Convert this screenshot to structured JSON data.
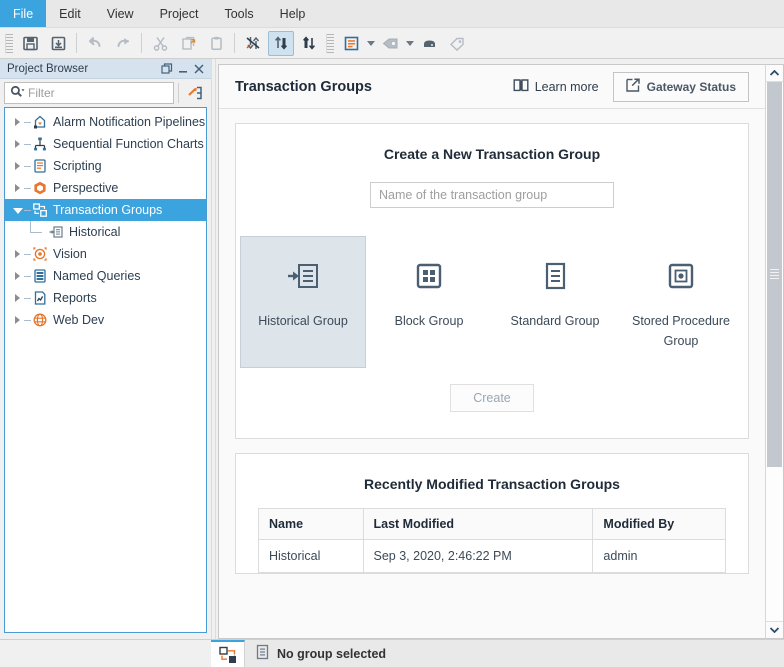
{
  "window": {
    "menu": [
      {
        "label": "File",
        "active": true
      },
      {
        "label": "Edit",
        "active": false
      },
      {
        "label": "View",
        "active": false
      },
      {
        "label": "Project",
        "active": false
      },
      {
        "label": "Tools",
        "active": false
      },
      {
        "label": "Help",
        "active": false
      }
    ],
    "toolbar": {
      "buttons": [
        {
          "name": "save-icon",
          "tooltip": "Save"
        },
        {
          "name": "save-all-icon",
          "tooltip": "Save All"
        },
        {
          "name": "undo-arrow-icon",
          "tooltip": "Undo"
        },
        {
          "name": "redo-arrow-icon",
          "tooltip": "Redo"
        },
        {
          "name": "cut-scissors-icon",
          "tooltip": "Cut"
        },
        {
          "name": "copy-icon",
          "tooltip": "Copy"
        },
        {
          "name": "paste-clipboard-icon",
          "tooltip": "Paste"
        },
        {
          "name": "disconnect-icon",
          "tooltip": "Disconnect"
        },
        {
          "name": "comm-read-write-icon",
          "tooltip": "Comm Read/Write",
          "selected": true
        },
        {
          "name": "comm-read-only-icon",
          "tooltip": "Comm Read Only"
        },
        {
          "name": "designer-mode-icon",
          "tooltip": "Designer Mode"
        },
        {
          "name": "tag-icon",
          "tooltip": "Tag Browser"
        },
        {
          "name": "database-icon",
          "tooltip": "Database"
        },
        {
          "name": "tags-icon",
          "tooltip": "Tags"
        }
      ]
    }
  },
  "project_browser": {
    "title": "Project Browser",
    "window_buttons": [
      {
        "name": "maximize-panel-icon"
      },
      {
        "name": "minimize-panel-icon"
      },
      {
        "name": "close-panel-icon"
      }
    ],
    "filter": {
      "placeholder": "Filter",
      "value": "",
      "search_icon": "search-dropdown-icon"
    },
    "goto_button": {
      "name": "jump-to-icon"
    },
    "tree": [
      {
        "label": "Alarm Notification Pipelines",
        "icon": "alarm-pipeline-icon",
        "expandable": true,
        "expanded": false,
        "depth": 0,
        "selected": false
      },
      {
        "label": "Sequential Function Charts",
        "icon": "sfc-icon",
        "expandable": true,
        "expanded": false,
        "depth": 0,
        "selected": false
      },
      {
        "label": "Scripting",
        "icon": "script-icon",
        "expandable": true,
        "expanded": false,
        "depth": 0,
        "selected": false
      },
      {
        "label": "Perspective",
        "icon": "perspective-icon",
        "expandable": true,
        "expanded": false,
        "depth": 0,
        "selected": false
      },
      {
        "label": "Transaction Groups",
        "icon": "transaction-group-icon",
        "expandable": true,
        "expanded": true,
        "depth": 0,
        "selected": true
      },
      {
        "label": "Historical",
        "icon": "historical-group-icon",
        "expandable": false,
        "expanded": false,
        "depth": 1,
        "selected": false
      },
      {
        "label": "Vision",
        "icon": "vision-icon",
        "expandable": true,
        "expanded": false,
        "depth": 0,
        "selected": false
      },
      {
        "label": "Named Queries",
        "icon": "named-query-icon",
        "expandable": true,
        "expanded": false,
        "depth": 0,
        "selected": false
      },
      {
        "label": "Reports",
        "icon": "report-icon",
        "expandable": true,
        "expanded": false,
        "depth": 0,
        "selected": false
      },
      {
        "label": "Web Dev",
        "icon": "webdev-globe-icon",
        "expandable": true,
        "expanded": false,
        "depth": 0,
        "selected": false
      }
    ]
  },
  "workspace": {
    "header": {
      "title": "Transaction Groups",
      "learn_more": {
        "label": "Learn more",
        "icon": "book-icon"
      },
      "gateway_status": {
        "label": "Gateway Status",
        "icon": "external-link-icon"
      }
    },
    "create_card": {
      "title": "Create a New Transaction Group",
      "name_input": {
        "placeholder": "Name of the transaction group",
        "value": ""
      },
      "types": [
        {
          "label": "Historical Group",
          "icon": "historical-group-icon",
          "selected": true
        },
        {
          "label": "Block Group",
          "icon": "block-group-icon",
          "selected": false
        },
        {
          "label": "Standard Group",
          "icon": "standard-group-icon",
          "selected": false
        },
        {
          "label": "Stored Procedure Group",
          "icon": "stored-procedure-group-icon",
          "selected": false
        }
      ],
      "create_button": {
        "label": "Create",
        "enabled": false
      }
    },
    "recent_card": {
      "title": "Recently Modified Transaction Groups",
      "columns": [
        "Name",
        "Last Modified",
        "Modified By"
      ],
      "rows": [
        [
          "Historical",
          "Sep 3, 2020, 2:46:22 PM",
          "admin"
        ]
      ]
    },
    "scrollbar": {
      "up_arrow": "chevron-up-icon",
      "down_arrow": "chevron-down-icon"
    }
  },
  "statusbar": {
    "tab_icon": "transaction-group-icon",
    "message_icon": "standard-group-icon",
    "message": "No group selected"
  },
  "colors": {
    "accent": "#3ba3dd",
    "panel_title_bg": "#d6e3ee",
    "selection": "#3ba3dd",
    "icon_blue": "#44627d",
    "icon_orange": "#e8762c",
    "card_bg": "#ffffff",
    "workspace_bg": "#fafafa",
    "selected_type_bg": "#dde4ea"
  }
}
